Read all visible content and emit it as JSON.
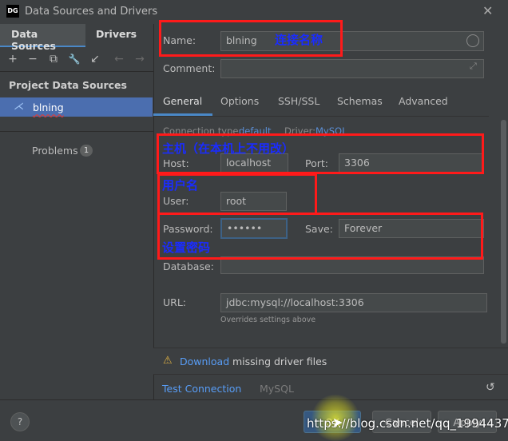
{
  "window": {
    "app_icon_text": "DG",
    "title": "Data Sources and Drivers",
    "close_icon": "close-icon"
  },
  "left_panel": {
    "tabs": [
      "Data Sources",
      "Drivers"
    ],
    "toolbar_icons": [
      "add-icon",
      "remove-icon",
      "duplicate-icon",
      "settings-icon",
      "import-icon",
      "back-icon",
      "forward-icon"
    ],
    "toolbar_glyphs": [
      "+",
      "−",
      "⧉",
      "🔧",
      "↙",
      "←",
      "→"
    ],
    "section_header": "Project Data Sources",
    "items": [
      {
        "label": "blning",
        "icon": "mysql-icon"
      }
    ],
    "problems_label": "Problems",
    "problems_count": "1"
  },
  "form": {
    "name_label": "Name:",
    "name_value": "blning",
    "comment_label": "Comment:",
    "comment_value": "",
    "tabs": [
      "General",
      "Options",
      "SSH/SSL",
      "Schemas",
      "Advanced"
    ],
    "active_tab": "General",
    "connection_type_label": "Connection type:",
    "connection_type_value": "default",
    "driver_label": "Driver:",
    "driver_value": "MySQL",
    "host_label": "Host:",
    "host_value": "localhost",
    "port_label": "Port:",
    "port_value": "3306",
    "user_label": "User:",
    "user_value": "root",
    "password_label": "Password:",
    "password_value": "••••••",
    "save_label": "Save:",
    "save_value": "Forever",
    "database_label": "Database:",
    "database_value": "",
    "url_label": "URL:",
    "url_value": "jdbc:mysql://localhost:3306",
    "overrides_text": "Overrides settings above"
  },
  "warning": {
    "link_text": "Download",
    "text": "missing driver files"
  },
  "bottom_bar": {
    "test_connection": "Test Connection",
    "driver_name": "MySQL"
  },
  "footer": {
    "help_label": "?",
    "ok_label": "OK",
    "cancel_label": "Cancel",
    "apply_label": "Apply"
  },
  "annotations": {
    "name": "连接名称",
    "host": "主机（在本机上不用改）",
    "user": "用户名",
    "password": "设置密码"
  },
  "watermark": "https://blog.csdn.net/qq_1994437",
  "colors": {
    "background": "#3c3f41",
    "accent": "#4a88c7",
    "selection": "#4b6eaf",
    "link": "#589df6",
    "annotation_box": "#ff1a1a",
    "annotation_text": "#1a2cff",
    "warning": "#e0b343"
  }
}
